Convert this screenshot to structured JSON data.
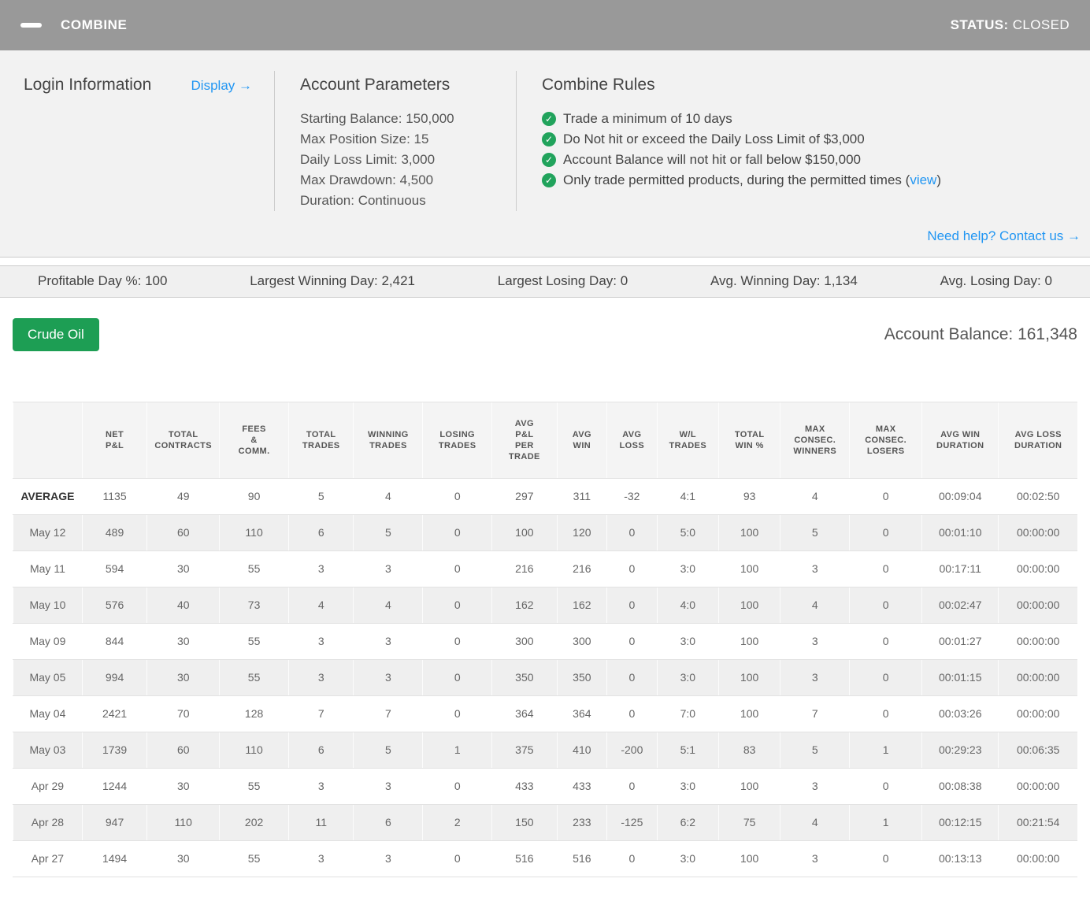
{
  "colors": {
    "topbar_gray": "#999999",
    "accent_blue": "#2196f3",
    "button_green": "#1d9e54",
    "check_green": "#21a35c"
  },
  "header": {
    "title": "COMBINE",
    "status_label": "STATUS:",
    "status_value": "CLOSED"
  },
  "info": {
    "login": {
      "title": "Login Information",
      "display_link": "Display →"
    },
    "parameters": {
      "title": "Account Parameters",
      "lines": [
        "Starting Balance: 150,000",
        "Max Position Size: 15",
        "Daily Loss Limit: 3,000",
        "Max Drawdown: 4,500",
        "Duration: Continuous"
      ]
    },
    "rules": {
      "title": "Combine Rules",
      "items": [
        {
          "text": "Trade a minimum of 10 days",
          "link": "",
          "after": ""
        },
        {
          "text": "Do Not hit or exceed the Daily Loss Limit of $3,000",
          "link": "",
          "after": ""
        },
        {
          "text": "Account Balance will not hit or fall below $150,000",
          "link": "",
          "after": ""
        },
        {
          "text": "Only trade permitted products, during the permitted times (",
          "link": "view",
          "after": ")"
        }
      ],
      "help_link": "Need help? Contact us →"
    }
  },
  "stats": [
    {
      "label": "Profitable Day %:",
      "value": "100"
    },
    {
      "label": "Largest Winning Day:",
      "value": "2,421"
    },
    {
      "label": "Largest Losing Day:",
      "value": "0"
    },
    {
      "label": "Avg. Winning Day:",
      "value": "1,134"
    },
    {
      "label": "Avg. Losing Day:",
      "value": "0"
    }
  ],
  "main": {
    "product_button": "Crude Oil",
    "balance_label": "Account Balance:",
    "balance_value": "161,348"
  },
  "table": {
    "columns": [
      "",
      "NET\nP&L",
      "TOTAL\nCONTRACTS",
      "FEES\n&\nCOMM.",
      "TOTAL\nTRADES",
      "WINNING\nTRADES",
      "LOSING\nTRADES",
      "AVG\nP&L\nPER\nTRADE",
      "AVG\nWIN",
      "AVG\nLOSS",
      "W/L\nTRADES",
      "TOTAL\nWIN %",
      "MAX\nCONSEC.\nWINNERS",
      "MAX\nCONSEC.\nLOSERS",
      "AVG WIN\nDURATION",
      "AVG LOSS\nDURATION"
    ],
    "rows": [
      {
        "label": "AVERAGE",
        "bold": true,
        "values": [
          "1135",
          "49",
          "90",
          "5",
          "4",
          "0",
          "297",
          "311",
          "-32",
          "4:1",
          "93",
          "4",
          "0",
          "00:09:04",
          "00:02:50"
        ]
      },
      {
        "label": "May 12",
        "bold": false,
        "values": [
          "489",
          "60",
          "110",
          "6",
          "5",
          "0",
          "100",
          "120",
          "0",
          "5:0",
          "100",
          "5",
          "0",
          "00:01:10",
          "00:00:00"
        ]
      },
      {
        "label": "May 11",
        "bold": false,
        "values": [
          "594",
          "30",
          "55",
          "3",
          "3",
          "0",
          "216",
          "216",
          "0",
          "3:0",
          "100",
          "3",
          "0",
          "00:17:11",
          "00:00:00"
        ]
      },
      {
        "label": "May 10",
        "bold": false,
        "values": [
          "576",
          "40",
          "73",
          "4",
          "4",
          "0",
          "162",
          "162",
          "0",
          "4:0",
          "100",
          "4",
          "0",
          "00:02:47",
          "00:00:00"
        ]
      },
      {
        "label": "May 09",
        "bold": false,
        "values": [
          "844",
          "30",
          "55",
          "3",
          "3",
          "0",
          "300",
          "300",
          "0",
          "3:0",
          "100",
          "3",
          "0",
          "00:01:27",
          "00:00:00"
        ]
      },
      {
        "label": "May 05",
        "bold": false,
        "values": [
          "994",
          "30",
          "55",
          "3",
          "3",
          "0",
          "350",
          "350",
          "0",
          "3:0",
          "100",
          "3",
          "0",
          "00:01:15",
          "00:00:00"
        ]
      },
      {
        "label": "May 04",
        "bold": false,
        "values": [
          "2421",
          "70",
          "128",
          "7",
          "7",
          "0",
          "364",
          "364",
          "0",
          "7:0",
          "100",
          "7",
          "0",
          "00:03:26",
          "00:00:00"
        ]
      },
      {
        "label": "May 03",
        "bold": false,
        "values": [
          "1739",
          "60",
          "110",
          "6",
          "5",
          "1",
          "375",
          "410",
          "-200",
          "5:1",
          "83",
          "5",
          "1",
          "00:29:23",
          "00:06:35"
        ]
      },
      {
        "label": "Apr 29",
        "bold": false,
        "values": [
          "1244",
          "30",
          "55",
          "3",
          "3",
          "0",
          "433",
          "433",
          "0",
          "3:0",
          "100",
          "3",
          "0",
          "00:08:38",
          "00:00:00"
        ]
      },
      {
        "label": "Apr 28",
        "bold": false,
        "values": [
          "947",
          "110",
          "202",
          "11",
          "6",
          "2",
          "150",
          "233",
          "-125",
          "6:2",
          "75",
          "4",
          "1",
          "00:12:15",
          "00:21:54"
        ]
      },
      {
        "label": "Apr 27",
        "bold": false,
        "values": [
          "1494",
          "30",
          "55",
          "3",
          "3",
          "0",
          "516",
          "516",
          "0",
          "3:0",
          "100",
          "3",
          "0",
          "00:13:13",
          "00:00:00"
        ]
      }
    ]
  }
}
